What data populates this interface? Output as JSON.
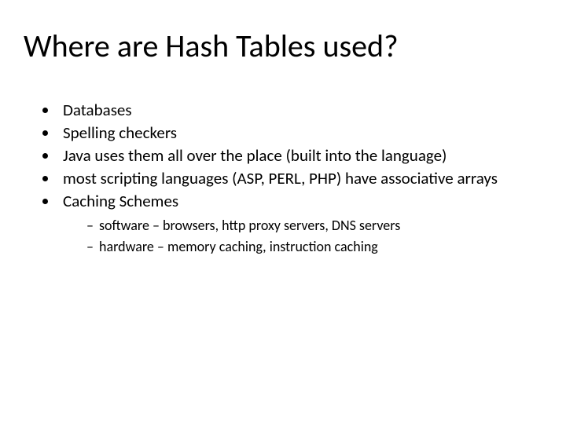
{
  "title": "Where are Hash Tables used?",
  "bullets": {
    "b0": "Databases",
    "b1": "Spelling checkers",
    "b2": "Java uses them all over the place (built into the language)",
    "b3": "most scripting languages (ASP, PERL, PHP) have associative arrays",
    "b4": "Caching Schemes"
  },
  "sub": {
    "s0": "software – browsers, http proxy servers, DNS servers",
    "s1": "hardware – memory caching, instruction caching"
  }
}
